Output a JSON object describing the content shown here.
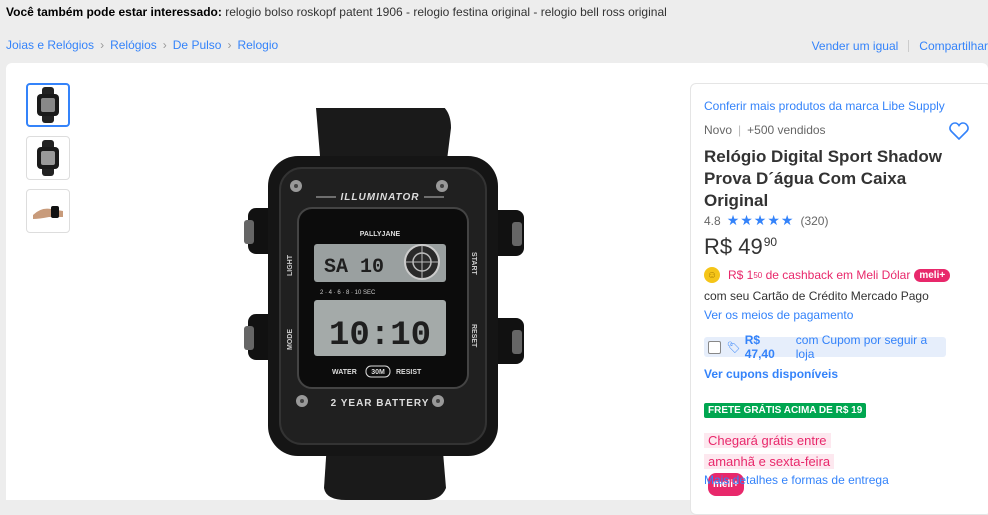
{
  "interest": {
    "label": "Você também pode estar interessado:",
    "items": "relogio bolso roskopf patent 1906 - relogio festina original - relogio bell ross original"
  },
  "breadcrumb": [
    "Joias e Relógios",
    "Relógios",
    "De Pulso",
    "Relogio"
  ],
  "actions": {
    "sell": "Vender um igual",
    "share": "Compartilhar"
  },
  "product": {
    "brand_link": "Conferir mais produtos da marca Libe Supply",
    "condition": "Novo",
    "sold": "+500 vendidos",
    "title": "Relógio Digital Sport Shadow Prova D´água Com Caixa Original",
    "rating": "4.8",
    "stars": "★★★★★",
    "reviews": "(320)",
    "currency": "R$",
    "price_int": "49",
    "price_cents": "90",
    "cashback_prefix": "R$ 1",
    "cashback_cents": "50",
    "cashback_suffix": "de cashback em Meli Dólar",
    "meli_badge": "meli+",
    "card_text": "com seu Cartão de Crédito Mercado Pago",
    "payment_link": "Ver os meios de pagamento",
    "coupon_amount": "R$ 47,40",
    "coupon_text": "com Cupom por seguir a loja",
    "coupons_link": "Ver cupons disponíveis",
    "free_shipping": "FRETE GRÁTIS ACIMA DE R$ 19",
    "arrive_line1": "Chegará grátis entre",
    "arrive_line2": "amanhã e sexta-feira",
    "shipping_link": "Mais detalhes e formas de entrega"
  },
  "watch": {
    "brand": "ILLUMINATOR",
    "logo": "PALLYJANE",
    "top_display": "SA 10",
    "main_display": "10:10",
    "water": "WATER",
    "depth": "30M",
    "resist": "RESIST",
    "battery": "2 YEAR BATTERY",
    "light": "LIGHT",
    "mode": "MODE",
    "start": "START",
    "reset": "RESET",
    "scale": "2 · 4 · 6 · 8 · 10 SEC"
  },
  "colors": {
    "accent": "#3483fa",
    "meli": "#e8286b",
    "green": "#00a650"
  }
}
